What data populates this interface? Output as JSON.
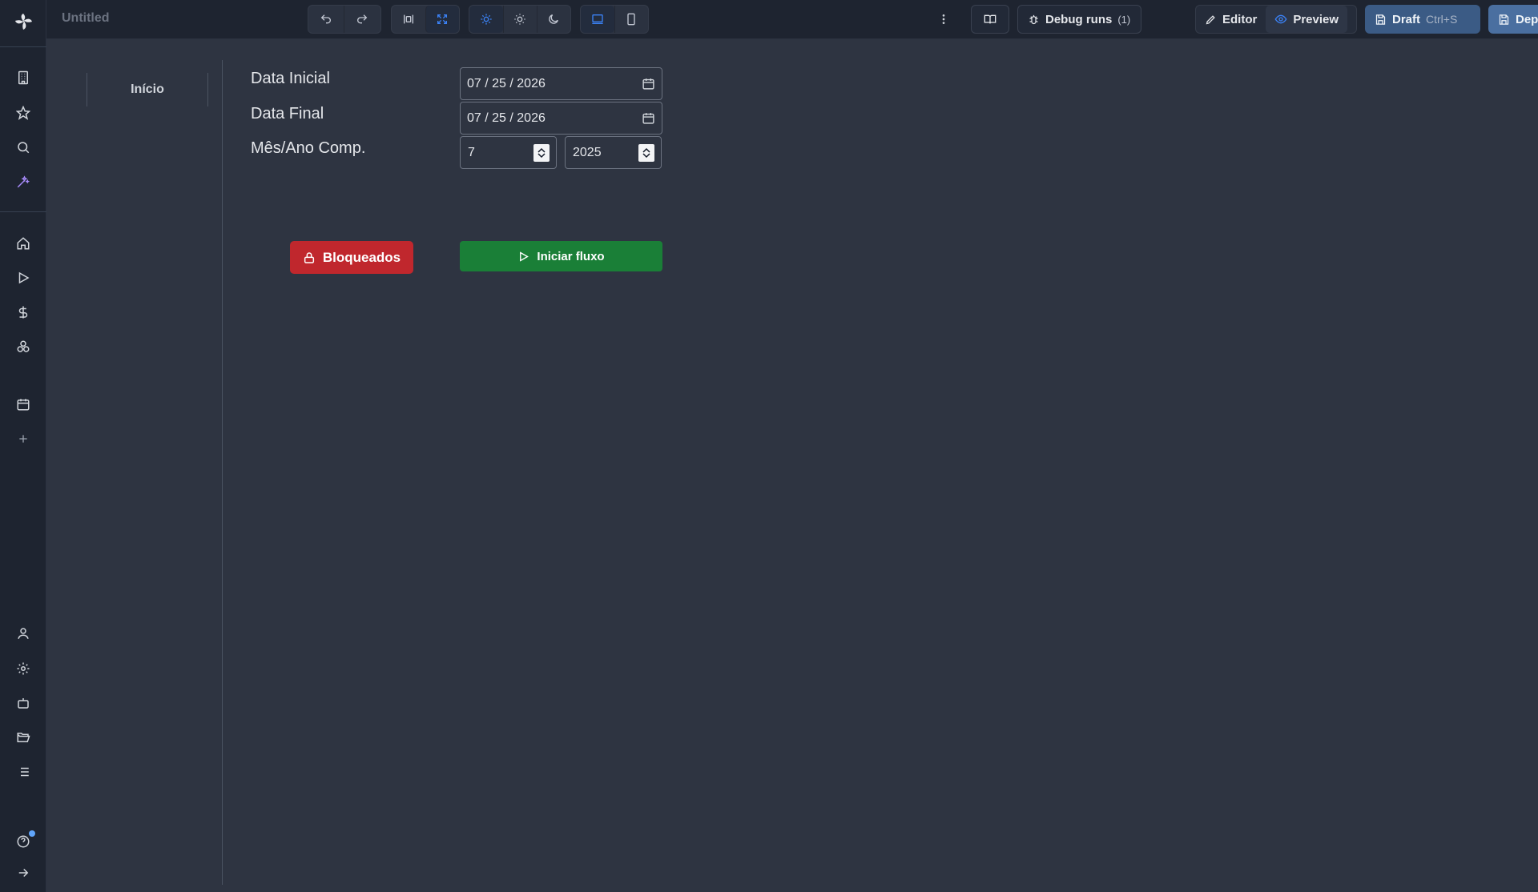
{
  "app": {
    "title": "Untitled"
  },
  "toolbar": {
    "more_label": "⋮",
    "debug_runs_label": "Debug runs",
    "debug_runs_count": "(1)",
    "editor_label": "Editor",
    "preview_label": "Preview",
    "draft_label": "Draft",
    "draft_shortcut": "Ctrl+S",
    "deploy_label": "Deploy"
  },
  "nav": {
    "inicio_label": "Início"
  },
  "form": {
    "data_inicial_label": "Data Inicial",
    "data_inicial_value": "07 / 25 / 2026",
    "data_final_label": "Data Final",
    "data_final_value": "07 / 25 / 2026",
    "mes_ano_label": "Mês/Ano Comp.",
    "mes_value": "7",
    "ano_value": "2025"
  },
  "actions": {
    "bloqueados_label": "Bloqueados",
    "iniciar_label": "Iniciar fluxo"
  },
  "colors": {
    "accent": "#3b82f6",
    "danger": "#c0272d",
    "success": "#1a7f37",
    "deploy": "#3b5b85"
  }
}
